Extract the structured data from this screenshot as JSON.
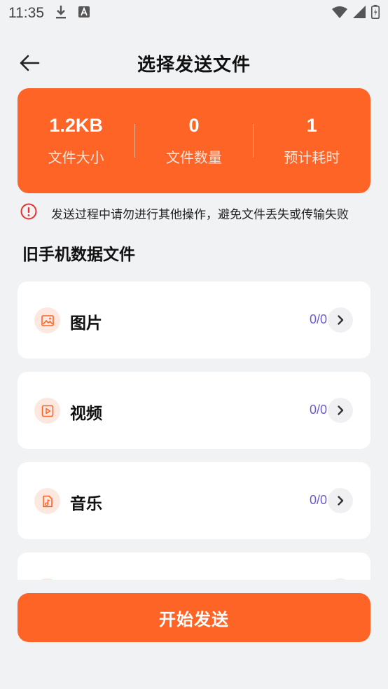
{
  "status_bar": {
    "time": "11:35"
  },
  "header": {
    "title": "选择发送文件"
  },
  "stats": [
    {
      "value": "1.2KB",
      "label": "文件大小"
    },
    {
      "value": "0",
      "label": "文件数量"
    },
    {
      "value": "1",
      "label": "预计耗时"
    }
  ],
  "warning": {
    "text": "发送过程中请勿进行其他操作，避免文件丢失或传输失败"
  },
  "section": {
    "title": "旧手机数据文件"
  },
  "items": [
    {
      "label": "图片",
      "count": "0/0",
      "icon": "image-icon"
    },
    {
      "label": "视频",
      "count": "0/0",
      "icon": "video-icon"
    },
    {
      "label": "音乐",
      "count": "0/0",
      "icon": "music-icon"
    }
  ],
  "start_button": {
    "label": "开始发送"
  },
  "colors": {
    "accent": "#ff6427",
    "count": "#6a5ad2",
    "background": "#f1f2f4"
  }
}
